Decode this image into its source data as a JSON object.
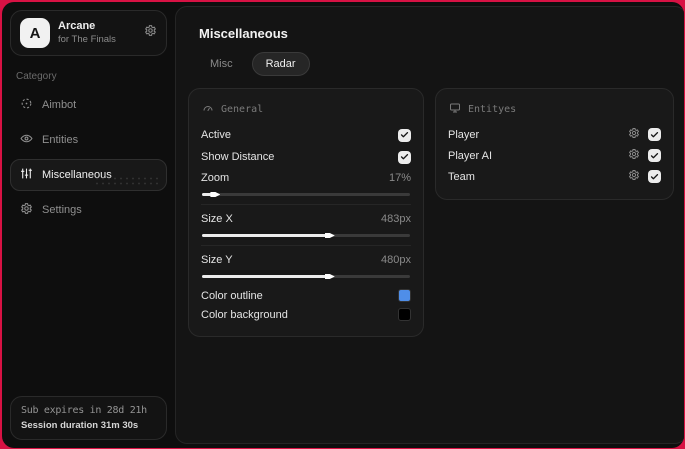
{
  "app": {
    "name": "Arcane",
    "subtitle": "for The Finals"
  },
  "colors": {
    "accent_red": "#d81244",
    "outline_swatch": "#4f8ee8",
    "background_swatch": "#000000"
  },
  "sidebar": {
    "category_label": "Category",
    "items": [
      {
        "label": "Aimbot",
        "icon": "crosshair-icon",
        "active": false
      },
      {
        "label": "Entities",
        "icon": "entities-icon",
        "active": false
      },
      {
        "label": "Miscellaneous",
        "icon": "sliders-icon",
        "active": true
      },
      {
        "label": "Settings",
        "icon": "gear-icon",
        "active": false
      }
    ],
    "footer": {
      "sub_expires": "Sub expires in 28d 21h",
      "session_duration": "Session duration 31m 30s"
    }
  },
  "main": {
    "title": "Miscellaneous",
    "tabs": [
      {
        "label": "Misc",
        "active": false
      },
      {
        "label": "Radar",
        "active": true
      }
    ],
    "general_panel": {
      "title": "General",
      "toggles": [
        {
          "label": "Active",
          "checked": true
        },
        {
          "label": "Show Distance",
          "checked": true
        }
      ],
      "sliders": [
        {
          "label": "Zoom",
          "value": "17%",
          "percent": 5
        },
        {
          "label": "Size X",
          "value": "483px",
          "percent": 60
        },
        {
          "label": "Size Y",
          "value": "480px",
          "percent": 60
        }
      ],
      "color_rows": [
        {
          "label": "Color outline",
          "color": "#4f8ee8"
        },
        {
          "label": "Color background",
          "color": "#000000"
        }
      ]
    },
    "entities_panel": {
      "title": "Entityes",
      "rows": [
        {
          "label": "Player",
          "checked": true
        },
        {
          "label": "Player AI",
          "checked": true
        },
        {
          "label": "Team",
          "checked": true
        }
      ]
    }
  }
}
